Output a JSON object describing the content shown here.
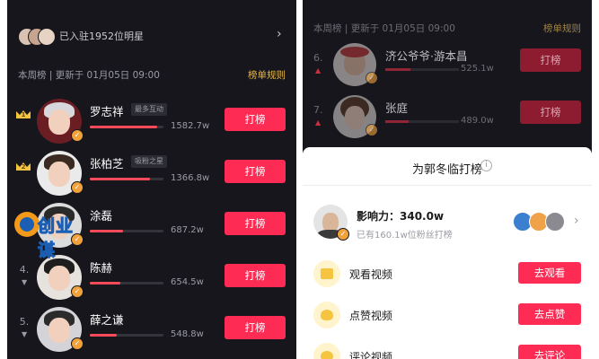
{
  "leaderboard": {
    "stars_bar": {
      "text": "已入驻1952位明星"
    },
    "week_bar": {
      "text": "本周榜 | 更新于 01月05日 09:00",
      "rules": "榜单规则"
    },
    "rows": [
      {
        "rank": "1",
        "crown": true,
        "name": "罗志祥",
        "tag": "最多互动",
        "score": "1582.7w",
        "progress": 0.92,
        "button": "打榜"
      },
      {
        "rank": "2",
        "crown": true,
        "name": "张柏芝",
        "tag": "吸粉之星",
        "score": "1366.8w",
        "progress": 0.82,
        "button": "打榜"
      },
      {
        "rank": "3",
        "crown": false,
        "name": "涂磊",
        "tag": "",
        "score": "687.2w",
        "progress": 0.45,
        "button": "打榜"
      },
      {
        "rank": "4.",
        "crown": false,
        "name": "陈赫",
        "tag": "",
        "score": "654.5w",
        "progress": 0.42,
        "button": "打榜"
      },
      {
        "rank": "5.",
        "crown": false,
        "name": "薛之谦",
        "tag": "",
        "score": "548.8w",
        "progress": 0.36,
        "button": "打榜"
      }
    ],
    "watermark": "创业谋"
  },
  "right": {
    "week_text": "本周榜 | 更新于 01月05日 09:00",
    "rules": "榜单规则",
    "rows": [
      {
        "rank": "6.",
        "name": "济公爷爷·游本昌",
        "score": "525.1w",
        "progress": 0.34,
        "button": "打榜"
      },
      {
        "rank": "7.",
        "name": "张庭",
        "score": "489.0w",
        "progress": 0.32,
        "button": "打榜"
      }
    ],
    "sheet": {
      "title": "为郭冬临打榜",
      "influence": "影响力：340.0w",
      "fans_text": "已有160.1w位粉丝打榜",
      "tasks": [
        {
          "label": "观看视频",
          "button": "去观看"
        },
        {
          "label": "点赞视频",
          "button": "去点赞"
        },
        {
          "label": "评论视频",
          "button": "去评论"
        }
      ]
    }
  },
  "colors": {
    "accent": "#fe2c55",
    "background": "#16161c",
    "gold": "#e8b84a",
    "progress": "#ff4a5a"
  }
}
